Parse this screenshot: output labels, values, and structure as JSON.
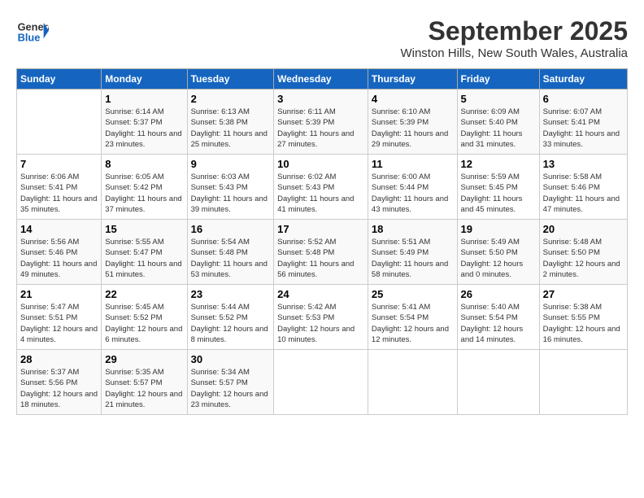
{
  "header": {
    "logo_line1": "General",
    "logo_line2": "Blue",
    "month": "September 2025",
    "location": "Winston Hills, New South Wales, Australia"
  },
  "days_of_week": [
    "Sunday",
    "Monday",
    "Tuesday",
    "Wednesday",
    "Thursday",
    "Friday",
    "Saturday"
  ],
  "weeks": [
    [
      {
        "num": "",
        "sunrise": "",
        "sunset": "",
        "daylight": ""
      },
      {
        "num": "1",
        "sunrise": "Sunrise: 6:14 AM",
        "sunset": "Sunset: 5:37 PM",
        "daylight": "Daylight: 11 hours and 23 minutes."
      },
      {
        "num": "2",
        "sunrise": "Sunrise: 6:13 AM",
        "sunset": "Sunset: 5:38 PM",
        "daylight": "Daylight: 11 hours and 25 minutes."
      },
      {
        "num": "3",
        "sunrise": "Sunrise: 6:11 AM",
        "sunset": "Sunset: 5:39 PM",
        "daylight": "Daylight: 11 hours and 27 minutes."
      },
      {
        "num": "4",
        "sunrise": "Sunrise: 6:10 AM",
        "sunset": "Sunset: 5:39 PM",
        "daylight": "Daylight: 11 hours and 29 minutes."
      },
      {
        "num": "5",
        "sunrise": "Sunrise: 6:09 AM",
        "sunset": "Sunset: 5:40 PM",
        "daylight": "Daylight: 11 hours and 31 minutes."
      },
      {
        "num": "6",
        "sunrise": "Sunrise: 6:07 AM",
        "sunset": "Sunset: 5:41 PM",
        "daylight": "Daylight: 11 hours and 33 minutes."
      }
    ],
    [
      {
        "num": "7",
        "sunrise": "Sunrise: 6:06 AM",
        "sunset": "Sunset: 5:41 PM",
        "daylight": "Daylight: 11 hours and 35 minutes."
      },
      {
        "num": "8",
        "sunrise": "Sunrise: 6:05 AM",
        "sunset": "Sunset: 5:42 PM",
        "daylight": "Daylight: 11 hours and 37 minutes."
      },
      {
        "num": "9",
        "sunrise": "Sunrise: 6:03 AM",
        "sunset": "Sunset: 5:43 PM",
        "daylight": "Daylight: 11 hours and 39 minutes."
      },
      {
        "num": "10",
        "sunrise": "Sunrise: 6:02 AM",
        "sunset": "Sunset: 5:43 PM",
        "daylight": "Daylight: 11 hours and 41 minutes."
      },
      {
        "num": "11",
        "sunrise": "Sunrise: 6:00 AM",
        "sunset": "Sunset: 5:44 PM",
        "daylight": "Daylight: 11 hours and 43 minutes."
      },
      {
        "num": "12",
        "sunrise": "Sunrise: 5:59 AM",
        "sunset": "Sunset: 5:45 PM",
        "daylight": "Daylight: 11 hours and 45 minutes."
      },
      {
        "num": "13",
        "sunrise": "Sunrise: 5:58 AM",
        "sunset": "Sunset: 5:46 PM",
        "daylight": "Daylight: 11 hours and 47 minutes."
      }
    ],
    [
      {
        "num": "14",
        "sunrise": "Sunrise: 5:56 AM",
        "sunset": "Sunset: 5:46 PM",
        "daylight": "Daylight: 11 hours and 49 minutes."
      },
      {
        "num": "15",
        "sunrise": "Sunrise: 5:55 AM",
        "sunset": "Sunset: 5:47 PM",
        "daylight": "Daylight: 11 hours and 51 minutes."
      },
      {
        "num": "16",
        "sunrise": "Sunrise: 5:54 AM",
        "sunset": "Sunset: 5:48 PM",
        "daylight": "Daylight: 11 hours and 53 minutes."
      },
      {
        "num": "17",
        "sunrise": "Sunrise: 5:52 AM",
        "sunset": "Sunset: 5:48 PM",
        "daylight": "Daylight: 11 hours and 56 minutes."
      },
      {
        "num": "18",
        "sunrise": "Sunrise: 5:51 AM",
        "sunset": "Sunset: 5:49 PM",
        "daylight": "Daylight: 11 hours and 58 minutes."
      },
      {
        "num": "19",
        "sunrise": "Sunrise: 5:49 AM",
        "sunset": "Sunset: 5:50 PM",
        "daylight": "Daylight: 12 hours and 0 minutes."
      },
      {
        "num": "20",
        "sunrise": "Sunrise: 5:48 AM",
        "sunset": "Sunset: 5:50 PM",
        "daylight": "Daylight: 12 hours and 2 minutes."
      }
    ],
    [
      {
        "num": "21",
        "sunrise": "Sunrise: 5:47 AM",
        "sunset": "Sunset: 5:51 PM",
        "daylight": "Daylight: 12 hours and 4 minutes."
      },
      {
        "num": "22",
        "sunrise": "Sunrise: 5:45 AM",
        "sunset": "Sunset: 5:52 PM",
        "daylight": "Daylight: 12 hours and 6 minutes."
      },
      {
        "num": "23",
        "sunrise": "Sunrise: 5:44 AM",
        "sunset": "Sunset: 5:52 PM",
        "daylight": "Daylight: 12 hours and 8 minutes."
      },
      {
        "num": "24",
        "sunrise": "Sunrise: 5:42 AM",
        "sunset": "Sunset: 5:53 PM",
        "daylight": "Daylight: 12 hours and 10 minutes."
      },
      {
        "num": "25",
        "sunrise": "Sunrise: 5:41 AM",
        "sunset": "Sunset: 5:54 PM",
        "daylight": "Daylight: 12 hours and 12 minutes."
      },
      {
        "num": "26",
        "sunrise": "Sunrise: 5:40 AM",
        "sunset": "Sunset: 5:54 PM",
        "daylight": "Daylight: 12 hours and 14 minutes."
      },
      {
        "num": "27",
        "sunrise": "Sunrise: 5:38 AM",
        "sunset": "Sunset: 5:55 PM",
        "daylight": "Daylight: 12 hours and 16 minutes."
      }
    ],
    [
      {
        "num": "28",
        "sunrise": "Sunrise: 5:37 AM",
        "sunset": "Sunset: 5:56 PM",
        "daylight": "Daylight: 12 hours and 18 minutes."
      },
      {
        "num": "29",
        "sunrise": "Sunrise: 5:35 AM",
        "sunset": "Sunset: 5:57 PM",
        "daylight": "Daylight: 12 hours and 21 minutes."
      },
      {
        "num": "30",
        "sunrise": "Sunrise: 5:34 AM",
        "sunset": "Sunset: 5:57 PM",
        "daylight": "Daylight: 12 hours and 23 minutes."
      },
      {
        "num": "",
        "sunrise": "",
        "sunset": "",
        "daylight": ""
      },
      {
        "num": "",
        "sunrise": "",
        "sunset": "",
        "daylight": ""
      },
      {
        "num": "",
        "sunrise": "",
        "sunset": "",
        "daylight": ""
      },
      {
        "num": "",
        "sunrise": "",
        "sunset": "",
        "daylight": ""
      }
    ]
  ]
}
